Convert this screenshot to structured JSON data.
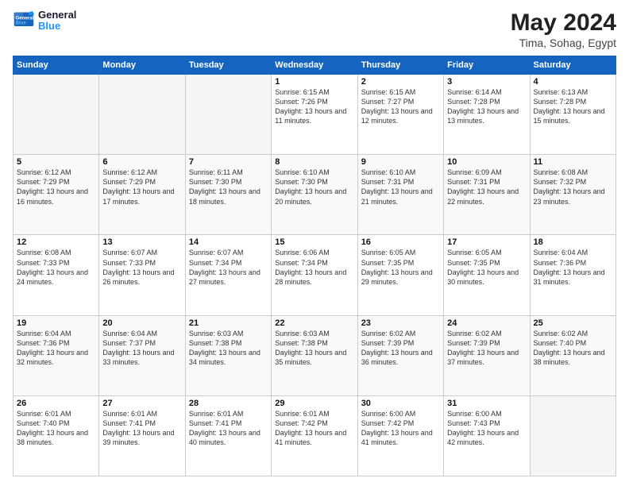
{
  "logo": {
    "line1": "General",
    "line2": "Blue"
  },
  "title": "May 2024",
  "subtitle": "Tima, Sohag, Egypt",
  "days_header": [
    "Sunday",
    "Monday",
    "Tuesday",
    "Wednesday",
    "Thursday",
    "Friday",
    "Saturday"
  ],
  "weeks": [
    [
      {
        "day": "",
        "info": ""
      },
      {
        "day": "",
        "info": ""
      },
      {
        "day": "",
        "info": ""
      },
      {
        "day": "1",
        "info": "Sunrise: 6:15 AM\nSunset: 7:26 PM\nDaylight: 13 hours\nand 11 minutes."
      },
      {
        "day": "2",
        "info": "Sunrise: 6:15 AM\nSunset: 7:27 PM\nDaylight: 13 hours\nand 12 minutes."
      },
      {
        "day": "3",
        "info": "Sunrise: 6:14 AM\nSunset: 7:28 PM\nDaylight: 13 hours\nand 13 minutes."
      },
      {
        "day": "4",
        "info": "Sunrise: 6:13 AM\nSunset: 7:28 PM\nDaylight: 13 hours\nand 15 minutes."
      }
    ],
    [
      {
        "day": "5",
        "info": "Sunrise: 6:12 AM\nSunset: 7:29 PM\nDaylight: 13 hours\nand 16 minutes."
      },
      {
        "day": "6",
        "info": "Sunrise: 6:12 AM\nSunset: 7:29 PM\nDaylight: 13 hours\nand 17 minutes."
      },
      {
        "day": "7",
        "info": "Sunrise: 6:11 AM\nSunset: 7:30 PM\nDaylight: 13 hours\nand 18 minutes."
      },
      {
        "day": "8",
        "info": "Sunrise: 6:10 AM\nSunset: 7:30 PM\nDaylight: 13 hours\nand 20 minutes."
      },
      {
        "day": "9",
        "info": "Sunrise: 6:10 AM\nSunset: 7:31 PM\nDaylight: 13 hours\nand 21 minutes."
      },
      {
        "day": "10",
        "info": "Sunrise: 6:09 AM\nSunset: 7:31 PM\nDaylight: 13 hours\nand 22 minutes."
      },
      {
        "day": "11",
        "info": "Sunrise: 6:08 AM\nSunset: 7:32 PM\nDaylight: 13 hours\nand 23 minutes."
      }
    ],
    [
      {
        "day": "12",
        "info": "Sunrise: 6:08 AM\nSunset: 7:33 PM\nDaylight: 13 hours\nand 24 minutes."
      },
      {
        "day": "13",
        "info": "Sunrise: 6:07 AM\nSunset: 7:33 PM\nDaylight: 13 hours\nand 26 minutes."
      },
      {
        "day": "14",
        "info": "Sunrise: 6:07 AM\nSunset: 7:34 PM\nDaylight: 13 hours\nand 27 minutes."
      },
      {
        "day": "15",
        "info": "Sunrise: 6:06 AM\nSunset: 7:34 PM\nDaylight: 13 hours\nand 28 minutes."
      },
      {
        "day": "16",
        "info": "Sunrise: 6:05 AM\nSunset: 7:35 PM\nDaylight: 13 hours\nand 29 minutes."
      },
      {
        "day": "17",
        "info": "Sunrise: 6:05 AM\nSunset: 7:35 PM\nDaylight: 13 hours\nand 30 minutes."
      },
      {
        "day": "18",
        "info": "Sunrise: 6:04 AM\nSunset: 7:36 PM\nDaylight: 13 hours\nand 31 minutes."
      }
    ],
    [
      {
        "day": "19",
        "info": "Sunrise: 6:04 AM\nSunset: 7:36 PM\nDaylight: 13 hours\nand 32 minutes."
      },
      {
        "day": "20",
        "info": "Sunrise: 6:04 AM\nSunset: 7:37 PM\nDaylight: 13 hours\nand 33 minutes."
      },
      {
        "day": "21",
        "info": "Sunrise: 6:03 AM\nSunset: 7:38 PM\nDaylight: 13 hours\nand 34 minutes."
      },
      {
        "day": "22",
        "info": "Sunrise: 6:03 AM\nSunset: 7:38 PM\nDaylight: 13 hours\nand 35 minutes."
      },
      {
        "day": "23",
        "info": "Sunrise: 6:02 AM\nSunset: 7:39 PM\nDaylight: 13 hours\nand 36 minutes."
      },
      {
        "day": "24",
        "info": "Sunrise: 6:02 AM\nSunset: 7:39 PM\nDaylight: 13 hours\nand 37 minutes."
      },
      {
        "day": "25",
        "info": "Sunrise: 6:02 AM\nSunset: 7:40 PM\nDaylight: 13 hours\nand 38 minutes."
      }
    ],
    [
      {
        "day": "26",
        "info": "Sunrise: 6:01 AM\nSunset: 7:40 PM\nDaylight: 13 hours\nand 38 minutes."
      },
      {
        "day": "27",
        "info": "Sunrise: 6:01 AM\nSunset: 7:41 PM\nDaylight: 13 hours\nand 39 minutes."
      },
      {
        "day": "28",
        "info": "Sunrise: 6:01 AM\nSunset: 7:41 PM\nDaylight: 13 hours\nand 40 minutes."
      },
      {
        "day": "29",
        "info": "Sunrise: 6:01 AM\nSunset: 7:42 PM\nDaylight: 13 hours\nand 41 minutes."
      },
      {
        "day": "30",
        "info": "Sunrise: 6:00 AM\nSunset: 7:42 PM\nDaylight: 13 hours\nand 41 minutes."
      },
      {
        "day": "31",
        "info": "Sunrise: 6:00 AM\nSunset: 7:43 PM\nDaylight: 13 hours\nand 42 minutes."
      },
      {
        "day": "",
        "info": ""
      }
    ]
  ]
}
